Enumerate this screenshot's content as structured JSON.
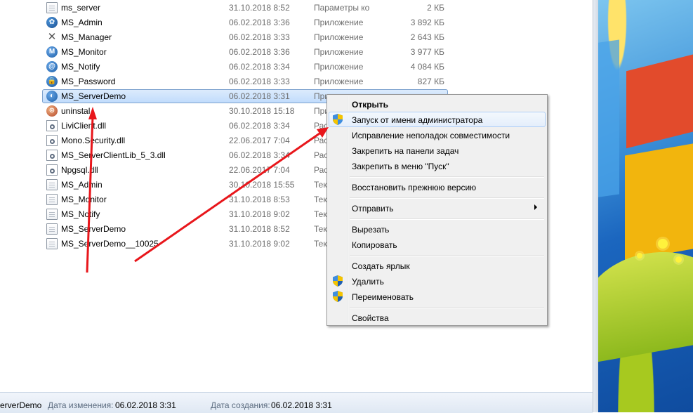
{
  "files": [
    {
      "name": "ms_server",
      "date": "31.10.2018 8:52",
      "type": "Параметры конф...",
      "size": "2 КБ",
      "icon": "config-file-icon"
    },
    {
      "name": "MS_Admin",
      "date": "06.02.2018 3:36",
      "type": "Приложение",
      "size": "3 892 КБ",
      "icon": "app-blue-icon"
    },
    {
      "name": "MS_Manager",
      "date": "06.02.2018 3:33",
      "type": "Приложение",
      "size": "2 643 КБ",
      "icon": "tools-icon"
    },
    {
      "name": "MS_Monitor",
      "date": "06.02.2018 3:36",
      "type": "Приложение",
      "size": "3 977 КБ",
      "icon": "monitor-m-icon"
    },
    {
      "name": "MS_Notify",
      "date": "06.02.2018 3:34",
      "type": "Приложение",
      "size": "4 084 КБ",
      "icon": "at-sign-icon"
    },
    {
      "name": "MS_Password",
      "date": "06.02.2018 3:33",
      "type": "Приложение",
      "size": "827 КБ",
      "icon": "lock-icon"
    },
    {
      "name": "MS_ServerDemo",
      "date": "06.02.2018 3:31",
      "type": "При",
      "size": "",
      "icon": "server-app-icon"
    },
    {
      "name": "uninstal",
      "date": "30.10.2018 15:18",
      "type": "При",
      "size": "",
      "icon": "uninstall-icon"
    },
    {
      "name": "LiviClient.dll",
      "date": "06.02.2018 3:34",
      "type": "Рас",
      "size": "",
      "icon": "dll-icon"
    },
    {
      "name": "Mono.Security.dll",
      "date": "22.06.2017 7:04",
      "type": "Рас",
      "size": "",
      "icon": "dll-icon"
    },
    {
      "name": "MS_ServerClientLib_5_3.dll",
      "date": "06.02.2018 3:34",
      "type": "Рас",
      "size": "",
      "icon": "dll-icon"
    },
    {
      "name": "Npgsql.dll",
      "date": "22.06.2017 7:04",
      "type": "Рас",
      "size": "",
      "icon": "dll-icon"
    },
    {
      "name": "MS_Admin",
      "date": "30.10.2018 15:55",
      "type": "Тек",
      "size": "",
      "icon": "text-file-icon"
    },
    {
      "name": "MS_Monitor",
      "date": "31.10.2018 8:53",
      "type": "Тек",
      "size": "",
      "icon": "text-file-icon"
    },
    {
      "name": "MS_Notify",
      "date": "31.10.2018 9:02",
      "type": "Тек",
      "size": "",
      "icon": "text-file-icon"
    },
    {
      "name": "MS_ServerDemo",
      "date": "31.10.2018 8:52",
      "type": "Тек",
      "size": "",
      "icon": "text-file-icon"
    },
    {
      "name": "MS_ServerDemo__10025",
      "date": "31.10.2018 9:02",
      "type": "Тек",
      "size": "",
      "icon": "text-file-icon"
    }
  ],
  "selected_index": 6,
  "context_menu": {
    "open": "Открыть",
    "run_as_admin": "Запуск от имени администратора",
    "troubleshoot": "Исправление неполадок совместимости",
    "pin_taskbar": "Закрепить на панели задач",
    "pin_start": "Закрепить в меню \"Пуск\"",
    "restore_previous": "Восстановить прежнюю версию",
    "send_to": "Отправить",
    "cut": "Вырезать",
    "copy": "Копировать",
    "create_shortcut": "Создать ярлык",
    "delete": "Удалить",
    "rename": "Переименовать",
    "properties": "Свойства"
  },
  "status": {
    "name": "erverDemo",
    "modified_label": "Дата изменения:",
    "modified_value": "06.02.2018 3:31",
    "created_label": "Дата создания:",
    "created_value": "06.02.2018 3:31"
  },
  "colors": {
    "annotation_arrow": "#e8161b",
    "selection": "#c1dcfc",
    "menu_bg": "#f0f0f0"
  }
}
